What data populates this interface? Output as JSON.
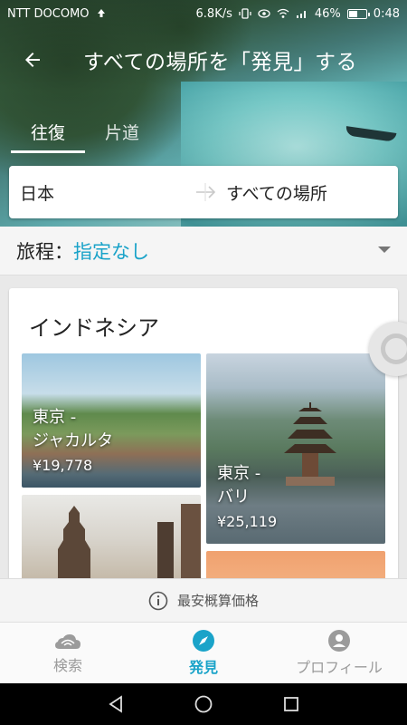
{
  "statusbar": {
    "carrier": "NTT DOCOMO",
    "speed": "6.8K/s",
    "battery_percent": "46%",
    "time": "0:48",
    "battery_level": 0.46
  },
  "header": {
    "title": "すべての場所を「発見」する"
  },
  "tabs": [
    {
      "label": "往復",
      "active": true
    },
    {
      "label": "片道",
      "active": false
    }
  ],
  "route": {
    "from": "日本",
    "to": "すべての場所"
  },
  "itinerary": {
    "label": "旅程：",
    "value": "指定なし"
  },
  "card": {
    "country": "インドネシア",
    "destinations": [
      {
        "label_line1": "東京 -",
        "label_line2": "ジャカルタ",
        "price": "¥19,778"
      },
      {
        "label_line1": "東京 -",
        "label_line2": "バリ",
        "price": "¥25,119"
      }
    ]
  },
  "notice": {
    "text": "最安概算価格",
    "icon": "info-icon"
  },
  "bottomnav": [
    {
      "label": "検索",
      "icon": "search-icon",
      "active": false
    },
    {
      "label": "発見",
      "icon": "compass-icon",
      "active": true
    },
    {
      "label": "プロフィール",
      "icon": "profile-icon",
      "active": false
    }
  ],
  "colors": {
    "accent": "#1aa3c9",
    "inactive": "#9b9b9b"
  }
}
